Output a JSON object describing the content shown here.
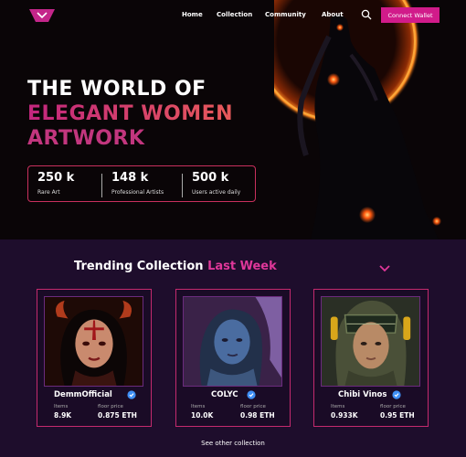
{
  "nav": {
    "links": [
      "Home",
      "Collection",
      "Community",
      "About"
    ],
    "connect_label": "Connect Wallet"
  },
  "hero": {
    "line1": "THE WORLD OF",
    "line2": "ELEGANT WOMEN",
    "line3": "ARTWORK",
    "stats": [
      {
        "value": "250 k",
        "label": "Rare Art"
      },
      {
        "value": "148 k",
        "label": "Professional Artists"
      },
      {
        "value": "500 k",
        "label": "Users active daily"
      }
    ]
  },
  "trending": {
    "title_white": "Trending Collection",
    "title_pink": "Last Week",
    "cards": [
      {
        "name": "DemmOfficial",
        "items_label": "Items",
        "items_value": "8.9K",
        "floor_label": "floor price",
        "floor_value": "0.875 ETH"
      },
      {
        "name": "COLYC",
        "items_label": "Items",
        "items_value": "10.0K",
        "floor_label": "floor price",
        "floor_value": "0.98 ETH"
      },
      {
        "name": "Chibi Vinos",
        "items_label": "Items",
        "items_value": "0.933K",
        "floor_label": "floor price",
        "floor_value": "0.95 ETH"
      }
    ],
    "see_other": "See other collection"
  },
  "colors": {
    "accent": "#d11b8a",
    "pink": "#e0379a",
    "border": "#c42a6e",
    "section_bg": "#1e0d2c"
  }
}
